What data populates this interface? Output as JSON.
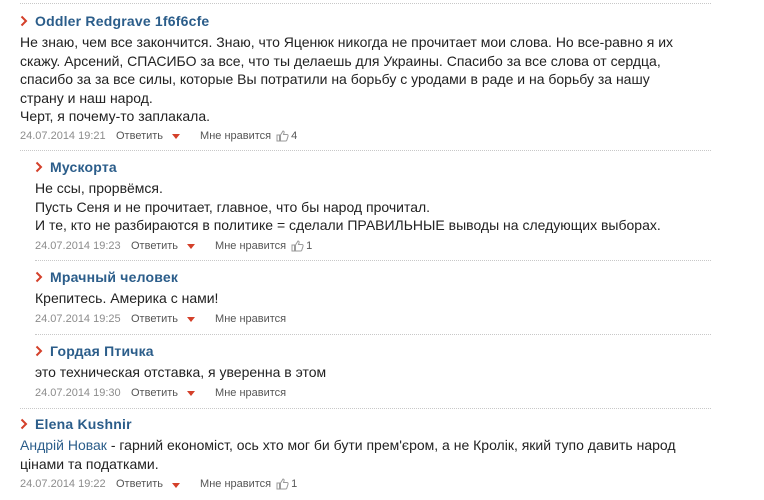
{
  "comments": [
    {
      "author": "Oddler Redgrave 1f6f6cfe",
      "lines": [
        "Не знаю, чем все закончится. Знаю, что Яценюк никогда не прочитает мои слова. Но все-равно я их",
        "скажу. Арсений, СПАСИБО за все, что ты делаешь для Украины. Спасибо за все слова от сердца,",
        "спасибо за за все силы, которые Вы потратили на борьбу с уродами в раде и на борьбу за нашу",
        "страну и наш народ.",
        "Черт, я почему-то заплакала."
      ],
      "date": "24.07.2014 19:21",
      "reply": "Ответить",
      "like": "Мне нравится",
      "likes": "4"
    },
    {
      "author": "Мускорта",
      "lines": [
        "Не ссы, прорвёмся.",
        "Пусть Сеня и не прочитает, главное, что бы народ прочитал.",
        "И те, кто не разбираются в политике = сделали ПРАВИЛЬНЫЕ выводы на следующих выборах."
      ],
      "date": "24.07.2014 19:23",
      "reply": "Ответить",
      "like": "Мне нравится",
      "likes": "1"
    },
    {
      "author": "Мрачный человек",
      "lines": [
        "Крепитесь. Америка с нами!"
      ],
      "date": "24.07.2014 19:25",
      "reply": "Ответить",
      "like": "Мне нравится"
    },
    {
      "author": "Гордая Птичка",
      "lines": [
        "это техническая отставка, я уверенна в этом"
      ],
      "date": "24.07.2014 19:30",
      "reply": "Ответить",
      "like": "Мне нравится"
    },
    {
      "author": "Elena Kushnir",
      "mention": "Андрій Новак",
      "first_line_rest": " - гарний економіст, ось хто мог би бути прем'єром, а не Кролік, який тупо давить народ",
      "lines": [
        "цінами та податками."
      ],
      "date": "24.07.2014 19:22",
      "reply": "Ответить",
      "like": "Мне нравится",
      "likes": "1"
    }
  ],
  "icons": {
    "author_marker": "chevron-right-icon",
    "reply_toggle": "caret-down-icon",
    "like": "thumbs-up-icon"
  },
  "colors": {
    "author": "#2b5d8a",
    "accent": "#d4402a",
    "meta": "#8c8c8c"
  }
}
